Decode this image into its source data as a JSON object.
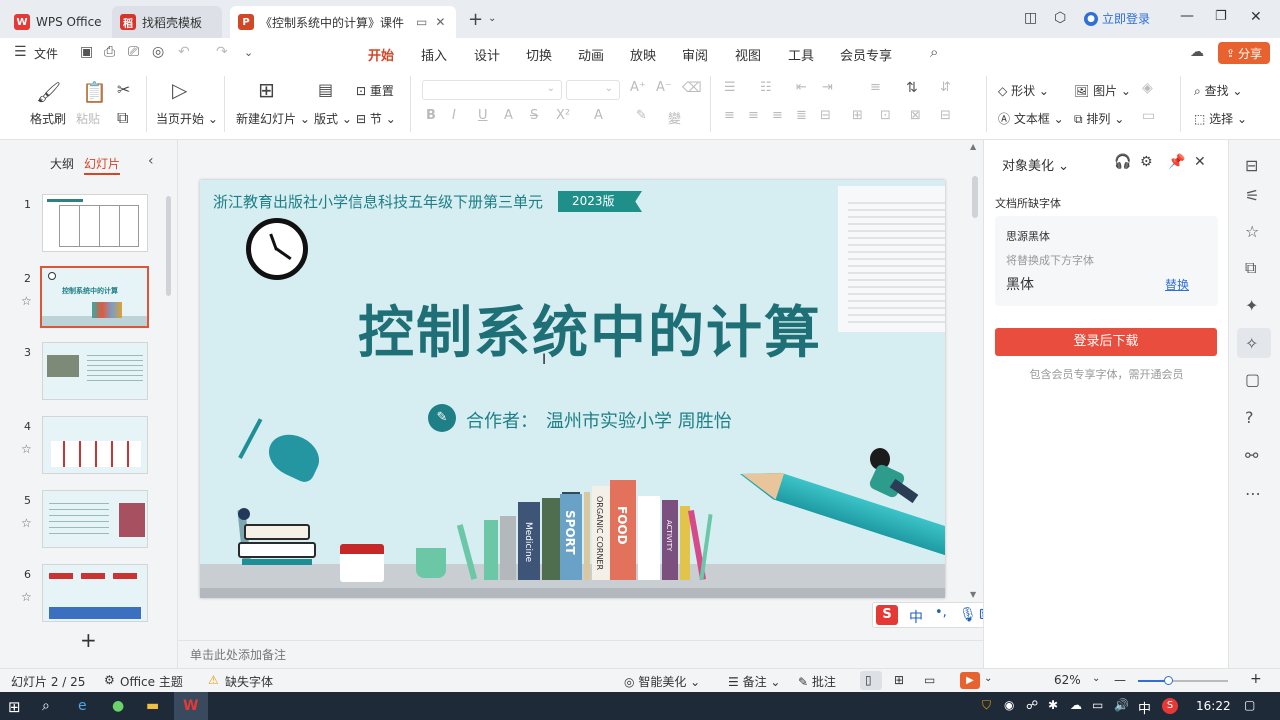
{
  "tabs": [
    {
      "label": "WPS Office",
      "icon": "wps-logo-icon"
    },
    {
      "label": "找稻壳模板",
      "icon": "docer-icon"
    },
    {
      "label": "《控制系统中的计算》课件（",
      "icon": "ppt-icon"
    }
  ],
  "window": {
    "login_label": "立即登录"
  },
  "menu": {
    "file_label": "文件",
    "tabs": [
      "开始",
      "插入",
      "设计",
      "切换",
      "动画",
      "放映",
      "审阅",
      "视图",
      "工具",
      "会员专享"
    ],
    "active_tab": "开始",
    "share_label": "分享"
  },
  "ribbon": {
    "format_painter": "格式刷",
    "paste": "粘贴",
    "from_current": "当页开始",
    "new_slide": "新建幻灯片",
    "layout": "版式",
    "reset": "重置",
    "section": "节",
    "shape": "形状",
    "picture": "图片",
    "find": "查找",
    "textbox": "文本框",
    "arrange": "排列",
    "select": "选择"
  },
  "left_panel": {
    "outline_tab": "大纲",
    "slides_tab": "幻灯片",
    "thumbnails": [
      "1",
      "2",
      "3",
      "4",
      "5",
      "6"
    ],
    "selected": "2"
  },
  "slide": {
    "header": "浙江教育出版社小学信息科技五年级下册第三单元",
    "badge": "2023版",
    "title": "控制系统中的计算",
    "author_label": "合作者：",
    "author": "温州市实验小学 周胜怡",
    "book_labels": [
      "SPORT",
      "FOOD",
      "ORGANIC CORNER",
      "Medicine",
      "ACTIVITY"
    ]
  },
  "notes": {
    "placeholder": "单击此处添加备注"
  },
  "right_panel": {
    "title": "对象美化",
    "section_label": "文档所缺字体",
    "missing_font": "思源黑体",
    "replace_hint": "将替换成下方字体",
    "replacement_font": "黑体",
    "replace_link": "替换",
    "download_button": "登录后下载",
    "footnote": "包含会员专享字体，需开通会员"
  },
  "ime": {
    "lang": "中",
    "punct": "•,"
  },
  "status": {
    "slide_info": "幻灯片 2 / 25",
    "theme": "Office 主题",
    "missing_font": "缺失字体",
    "smart_beautify": "智能美化",
    "notes": "备注",
    "comments": "批注",
    "zoom": "62%"
  },
  "taskbar": {
    "lang": "中",
    "time": "16:22"
  },
  "colors": {
    "accent": "#d24726",
    "slide_teal": "#1f7f86",
    "slide_bg": "#d6eef2",
    "download_red": "#e84d3d"
  }
}
